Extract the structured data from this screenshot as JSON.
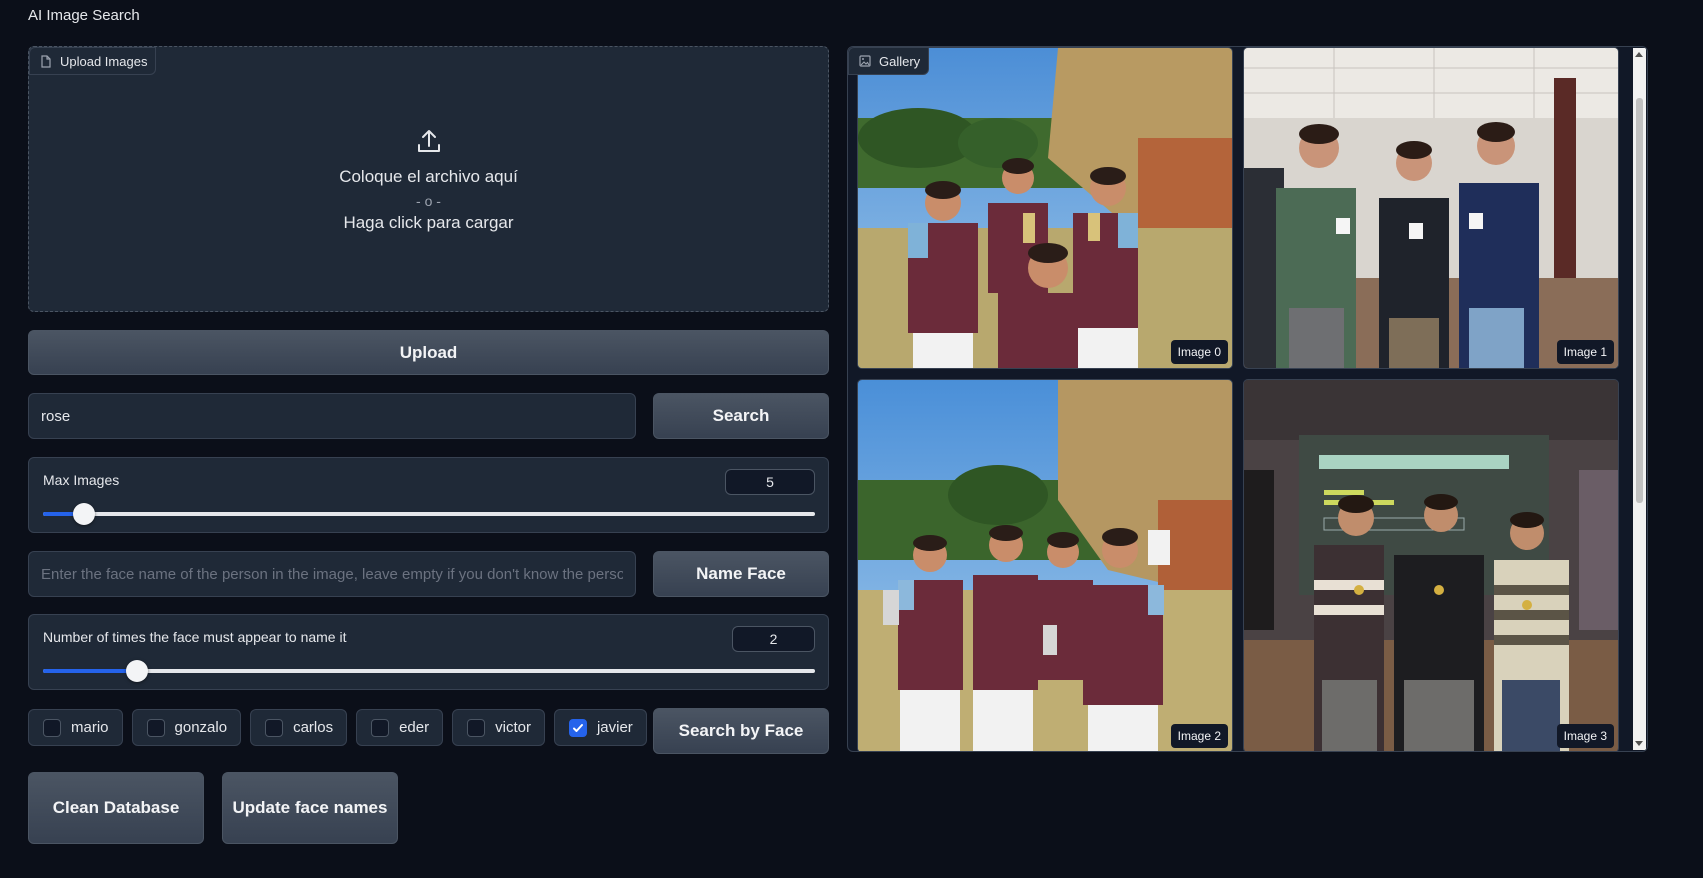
{
  "app": {
    "title": "AI Image Search"
  },
  "upload": {
    "label": "Upload Images",
    "drop_text": "Coloque el archivo aquí",
    "or_text": "- o -",
    "click_text": "Haga click para cargar",
    "button_label": "Upload"
  },
  "search": {
    "value": "rose",
    "button_label": "Search"
  },
  "max_images": {
    "label": "Max Images",
    "value": "5",
    "fraction": 0.053
  },
  "name_face": {
    "placeholder": "Enter the face name of the person in the image, leave empty if you don't know the person",
    "button_label": "Name Face"
  },
  "face_count": {
    "label": "Number of times the face must appear to name it",
    "value": "2",
    "fraction": 0.122
  },
  "faces": [
    {
      "label": "mario",
      "checked": false
    },
    {
      "label": "gonzalo",
      "checked": false
    },
    {
      "label": "carlos",
      "checked": false
    },
    {
      "label": "eder",
      "checked": false
    },
    {
      "label": "victor",
      "checked": false
    },
    {
      "label": "javier",
      "checked": true
    }
  ],
  "buttons": {
    "search_by_face": "Search by Face",
    "clean_database": "Clean Database",
    "update_face_names": "Update face names"
  },
  "gallery": {
    "label": "Gallery",
    "images": [
      {
        "caption": "Image 0"
      },
      {
        "caption": "Image 1"
      },
      {
        "caption": "Image 2"
      },
      {
        "caption": "Image 3"
      }
    ]
  },
  "colors": {
    "accent": "#2563eb",
    "background": "#0b0f19",
    "panel": "#1f2937"
  }
}
